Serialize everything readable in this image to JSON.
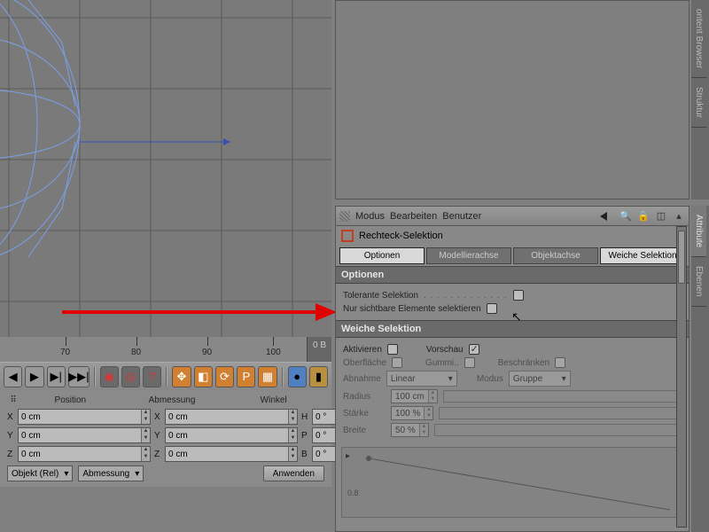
{
  "ruler": {
    "ticks": [
      "70",
      "80",
      "90",
      "100"
    ],
    "frame_label": "0 B"
  },
  "coords": {
    "headers": {
      "pos": "Position",
      "dim": "Abmessung",
      "ang": "Winkel"
    },
    "rows": [
      {
        "l": "X",
        "v1": "0 cm",
        "v2": "0 cm",
        "l3": "H",
        "v3": "0 °"
      },
      {
        "l": "Y",
        "v1": "0 cm",
        "v2": "0 cm",
        "l3": "P",
        "v3": "0 °"
      },
      {
        "l": "Z",
        "v1": "0 cm",
        "v2": "0 cm",
        "l3": "B",
        "v3": "0 °"
      }
    ],
    "mode": "Objekt (Rel)",
    "dim_btn": "Abmessung",
    "apply": "Anwenden"
  },
  "attr": {
    "menu": {
      "mode": "Modus",
      "edit": "Bearbeiten",
      "user": "Benutzer"
    },
    "tool": "Rechteck-Selektion",
    "tabs": {
      "opt": "Optionen",
      "model": "Modellierachse",
      "obj": "Objektachse",
      "soft": "Weiche Selektion"
    },
    "sec_options": "Optionen",
    "tol": "Tolerante Selektion",
    "vis": "Nur sichtbare Elemente selektieren",
    "sec_soft": "Weiche Selektion",
    "act": "Aktivieren",
    "prev": "Vorschau",
    "surf": "Oberfläche",
    "rubber": "Gummi..",
    "restrict": "Beschränken",
    "falloff": "Abnahme",
    "falloff_v": "Linear",
    "mode": "Modus",
    "mode_v": "Gruppe",
    "radius": "Radius",
    "radius_v": "100 cm",
    "strength": "Stärke",
    "strength_v": "100 %",
    "width": "Breite",
    "width_v": "50 %",
    "curve_y": "0.8"
  },
  "side": {
    "content": "ontent Browser",
    "struct": "Struktur",
    "attribute": "Attribute",
    "layers": "Ebenen"
  }
}
